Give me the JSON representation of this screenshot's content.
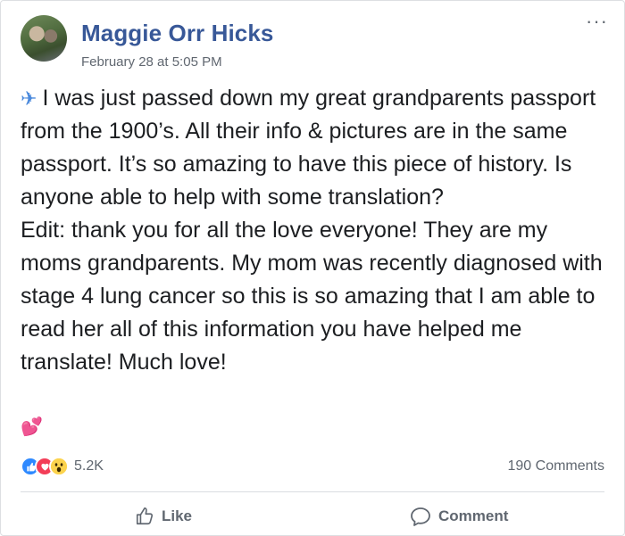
{
  "post": {
    "author": "Maggie Orr Hicks",
    "timestamp": "February 28 at 5:05 PM",
    "paragraph1": "I was just passed down my great grandparents passport from the 1900’s. All their info & pictures are in the same passport. It’s so amazing to have this piece of history. Is anyone able to help with some translation?",
    "paragraph2": "Edit: thank you for all the love everyone! They are my moms grandparents. My mom was recently diagnosed with stage 4 lung cancer so this is so amazing that I am able to read her all of this information you have helped me translate! Much love!",
    "emoji_start": "airplane-icon",
    "emoji_end": "heart-icon"
  },
  "stats": {
    "reaction_count": "5.2K",
    "reactions": [
      "like",
      "love",
      "wow"
    ],
    "comments": "190 Comments"
  },
  "actions": {
    "like_label": "Like",
    "comment_label": "Comment"
  },
  "colors": {
    "author": "#385898",
    "meta": "#606770",
    "like": "#2e89ff",
    "love": "#f33e58",
    "wow": "#fcd34d"
  }
}
